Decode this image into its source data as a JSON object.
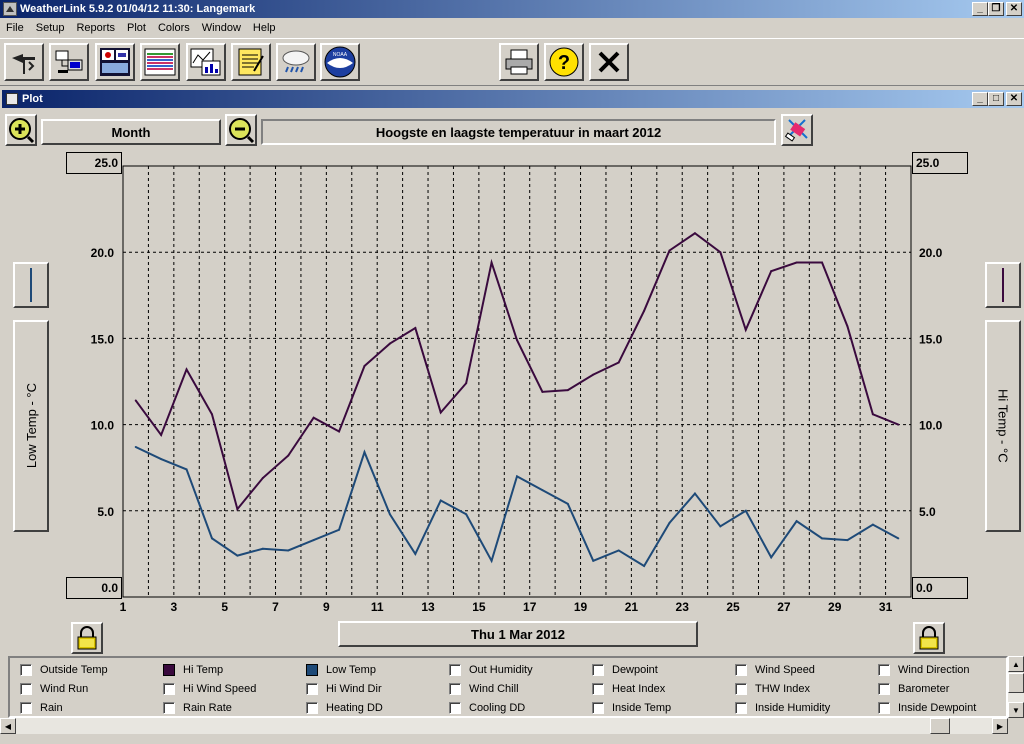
{
  "app": {
    "title": "WeatherLink 5.9.2  01/04/12  11:30: Langemark",
    "menu": [
      "File",
      "Setup",
      "Reports",
      "Plot",
      "Colors",
      "Window",
      "Help"
    ]
  },
  "toolbar": {
    "buttons": [
      "station-icon",
      "download-icon",
      "bulletin-icon",
      "browse-icon",
      "plot-icon",
      "notes-icon",
      "weather-icon",
      "noaa-icon",
      "print-icon",
      "help-icon",
      "close-icon"
    ],
    "noaa_label": "NOAA"
  },
  "plot_window": {
    "title": "Plot",
    "span_label": "Month",
    "chart_title": "Hoogste en laagste temperatuur in maart 2012",
    "date_label": "Thu 1 Mar 2012"
  },
  "chart_data": {
    "type": "line",
    "title": "Hoogste en laagste temperatuur in maart 2012",
    "xlabel": "Thu 1 Mar 2012",
    "ylabel_left": "Low Temp - °C",
    "ylabel_right": "Hi Temp - °C",
    "x_ticks": [
      "1",
      "3",
      "5",
      "7",
      "9",
      "11",
      "13",
      "15",
      "17",
      "19",
      "21",
      "23",
      "25",
      "27",
      "29",
      "31"
    ],
    "xlim": [
      1,
      32
    ],
    "ylim": [
      0,
      25
    ],
    "y_ticks": [
      "0.0",
      "5.0",
      "10.0",
      "15.0",
      "20.0",
      "25.0"
    ],
    "grid": true,
    "x": [
      1.5,
      2.5,
      3.5,
      4.5,
      5.5,
      6.5,
      7.5,
      8.5,
      9.5,
      10.5,
      11.5,
      12.5,
      13.5,
      14.5,
      15.5,
      16.5,
      17.5,
      18.5,
      19.5,
      20.5,
      21.5,
      22.5,
      23.5,
      24.5,
      25.5,
      26.5,
      27.5,
      28.5,
      29.5,
      30.5,
      31.5
    ],
    "series": [
      {
        "name": "Hi Temp",
        "color": "#3a0a3e",
        "values": [
          11.4,
          9.4,
          13.2,
          10.6,
          5.1,
          6.9,
          8.2,
          10.4,
          9.6,
          13.4,
          14.7,
          15.6,
          10.7,
          12.4,
          19.4,
          14.9,
          11.9,
          12.0,
          12.9,
          13.6,
          16.6,
          20.1,
          21.1,
          20.0,
          15.5,
          18.9,
          19.4,
          19.4,
          15.7,
          10.6,
          10.0
        ]
      },
      {
        "name": "Low Temp",
        "color": "#1e4a78",
        "values": [
          8.7,
          8.0,
          7.4,
          3.4,
          2.4,
          2.8,
          2.7,
          3.3,
          3.9,
          8.4,
          4.8,
          2.5,
          5.6,
          4.8,
          2.1,
          7.0,
          6.2,
          5.4,
          2.1,
          2.7,
          1.8,
          4.3,
          6.0,
          4.1,
          5.0,
          2.3,
          4.4,
          3.4,
          3.3,
          4.2,
          3.4
        ]
      }
    ]
  },
  "legend": {
    "items": [
      {
        "label": "Outside Temp",
        "color": ""
      },
      {
        "label": "Hi Temp",
        "color": "#3a0a3e"
      },
      {
        "label": "Low Temp",
        "color": "#1e4a78"
      },
      {
        "label": "Out Humidity",
        "color": ""
      },
      {
        "label": "Dewpoint",
        "color": ""
      },
      {
        "label": "Wind Speed",
        "color": ""
      },
      {
        "label": "Wind Direction",
        "color": ""
      },
      {
        "label": "Wind Run",
        "color": ""
      },
      {
        "label": "Hi Wind Speed",
        "color": ""
      },
      {
        "label": "Hi Wind Dir",
        "color": ""
      },
      {
        "label": "Wind Chill",
        "color": ""
      },
      {
        "label": "Heat Index",
        "color": ""
      },
      {
        "label": "THW Index",
        "color": ""
      },
      {
        "label": "Barometer",
        "color": ""
      },
      {
        "label": "Rain",
        "color": ""
      },
      {
        "label": "Rain Rate",
        "color": ""
      },
      {
        "label": "Heating DD",
        "color": ""
      },
      {
        "label": "Cooling DD",
        "color": ""
      },
      {
        "label": "Inside Temp",
        "color": ""
      },
      {
        "label": "Inside Humidity",
        "color": ""
      },
      {
        "label": "Inside Dewpoint",
        "color": ""
      }
    ]
  }
}
